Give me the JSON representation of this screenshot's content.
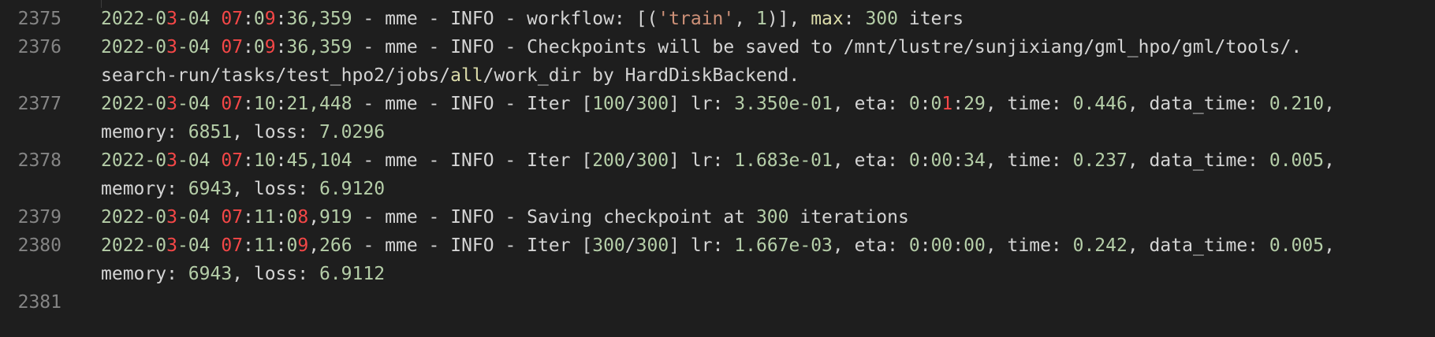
{
  "editor": {
    "lines": [
      {
        "number": "2375",
        "rows": [
          [
            [
              "n",
              "2022-0"
            ],
            [
              "r",
              "3"
            ],
            [
              "n",
              "-04 "
            ],
            [
              "r",
              "07"
            ],
            [
              "t",
              ":"
            ],
            [
              "n",
              "0"
            ],
            [
              "r",
              "9"
            ],
            [
              "t",
              ":"
            ],
            [
              "n",
              "36,359"
            ],
            [
              "t",
              " - mme - INFO - workflow: [("
            ],
            [
              "s",
              "'train'"
            ],
            [
              "t",
              ", "
            ],
            [
              "n",
              "1"
            ],
            [
              "t",
              ")], "
            ],
            [
              "y",
              "max"
            ],
            [
              "t",
              ": "
            ],
            [
              "n",
              "300"
            ],
            [
              "t",
              " iters"
            ]
          ]
        ]
      },
      {
        "number": "2376",
        "rows": [
          [
            [
              "n",
              "2022-0"
            ],
            [
              "r",
              "3"
            ],
            [
              "n",
              "-04 "
            ],
            [
              "r",
              "07"
            ],
            [
              "t",
              ":"
            ],
            [
              "n",
              "0"
            ],
            [
              "r",
              "9"
            ],
            [
              "t",
              ":"
            ],
            [
              "n",
              "36,359"
            ],
            [
              "t",
              " - mme - INFO - Checkpoints will be saved to /mnt/lustre/sunjixiang/gml_hpo/gml/tools/."
            ]
          ],
          [
            [
              "t",
              "search-run/tasks/test_hpo2/jobs/"
            ],
            [
              "y",
              "all"
            ],
            [
              "t",
              "/work_dir by HardDiskBackend."
            ]
          ]
        ]
      },
      {
        "number": "2377",
        "rows": [
          [
            [
              "n",
              "2022-0"
            ],
            [
              "r",
              "3"
            ],
            [
              "n",
              "-04 "
            ],
            [
              "r",
              "07"
            ],
            [
              "t",
              ":"
            ],
            [
              "n",
              "10"
            ],
            [
              "t",
              ":"
            ],
            [
              "n",
              "21,448"
            ],
            [
              "t",
              " - mme - INFO - Iter ["
            ],
            [
              "n",
              "100"
            ],
            [
              "t",
              "/"
            ],
            [
              "n",
              "300"
            ],
            [
              "t",
              "] lr: "
            ],
            [
              "n",
              "3.350e-01"
            ],
            [
              "t",
              ", eta: "
            ],
            [
              "n",
              "0"
            ],
            [
              "t",
              ":"
            ],
            [
              "n",
              "0"
            ],
            [
              "r",
              "1"
            ],
            [
              "t",
              ":"
            ],
            [
              "n",
              "29"
            ],
            [
              "t",
              ", time: "
            ],
            [
              "n",
              "0.446"
            ],
            [
              "t",
              ", data_time: "
            ],
            [
              "n",
              "0.210"
            ],
            [
              "t",
              ","
            ]
          ],
          [
            [
              "t",
              "memory: "
            ],
            [
              "n",
              "6851"
            ],
            [
              "t",
              ", loss: "
            ],
            [
              "n",
              "7.0296"
            ]
          ]
        ]
      },
      {
        "number": "2378",
        "rows": [
          [
            [
              "n",
              "2022-0"
            ],
            [
              "r",
              "3"
            ],
            [
              "n",
              "-04 "
            ],
            [
              "r",
              "07"
            ],
            [
              "t",
              ":"
            ],
            [
              "n",
              "10"
            ],
            [
              "t",
              ":"
            ],
            [
              "n",
              "45,104"
            ],
            [
              "t",
              " - mme - INFO - Iter ["
            ],
            [
              "n",
              "200"
            ],
            [
              "t",
              "/"
            ],
            [
              "n",
              "300"
            ],
            [
              "t",
              "] lr: "
            ],
            [
              "n",
              "1.683e-01"
            ],
            [
              "t",
              ", eta: "
            ],
            [
              "n",
              "0"
            ],
            [
              "t",
              ":"
            ],
            [
              "n",
              "00"
            ],
            [
              "t",
              ":"
            ],
            [
              "n",
              "34"
            ],
            [
              "t",
              ", time: "
            ],
            [
              "n",
              "0.237"
            ],
            [
              "t",
              ", data_time: "
            ],
            [
              "n",
              "0.005"
            ],
            [
              "t",
              ","
            ]
          ],
          [
            [
              "t",
              "memory: "
            ],
            [
              "n",
              "6943"
            ],
            [
              "t",
              ", loss: "
            ],
            [
              "n",
              "6.9120"
            ]
          ]
        ]
      },
      {
        "number": "2379",
        "rows": [
          [
            [
              "n",
              "2022-0"
            ],
            [
              "r",
              "3"
            ],
            [
              "n",
              "-04 "
            ],
            [
              "r",
              "07"
            ],
            [
              "t",
              ":"
            ],
            [
              "n",
              "11"
            ],
            [
              "t",
              ":"
            ],
            [
              "n",
              "0"
            ],
            [
              "r",
              "8"
            ],
            [
              "t",
              ","
            ],
            [
              "n",
              "919"
            ],
            [
              "t",
              " - mme - INFO - Saving checkpoint at "
            ],
            [
              "n",
              "300"
            ],
            [
              "t",
              " iterations"
            ]
          ]
        ]
      },
      {
        "number": "2380",
        "rows": [
          [
            [
              "n",
              "2022-0"
            ],
            [
              "r",
              "3"
            ],
            [
              "n",
              "-04 "
            ],
            [
              "r",
              "07"
            ],
            [
              "t",
              ":"
            ],
            [
              "n",
              "11"
            ],
            [
              "t",
              ":"
            ],
            [
              "n",
              "0"
            ],
            [
              "r",
              "9"
            ],
            [
              "t",
              ","
            ],
            [
              "n",
              "266"
            ],
            [
              "t",
              " - mme - INFO - Iter ["
            ],
            [
              "n",
              "300"
            ],
            [
              "t",
              "/"
            ],
            [
              "n",
              "300"
            ],
            [
              "t",
              "] lr: "
            ],
            [
              "n",
              "1.667e-03"
            ],
            [
              "t",
              ", eta: "
            ],
            [
              "n",
              "0"
            ],
            [
              "t",
              ":"
            ],
            [
              "n",
              "00"
            ],
            [
              "t",
              ":"
            ],
            [
              "n",
              "00"
            ],
            [
              "t",
              ", time: "
            ],
            [
              "n",
              "0.242"
            ],
            [
              "t",
              ", data_time: "
            ],
            [
              "n",
              "0.005"
            ],
            [
              "t",
              ","
            ]
          ],
          [
            [
              "t",
              "memory: "
            ],
            [
              "n",
              "6943"
            ],
            [
              "t",
              ", loss: "
            ],
            [
              "n",
              "6.9112"
            ]
          ]
        ]
      },
      {
        "number": "2381",
        "rows": [
          []
        ]
      }
    ]
  }
}
